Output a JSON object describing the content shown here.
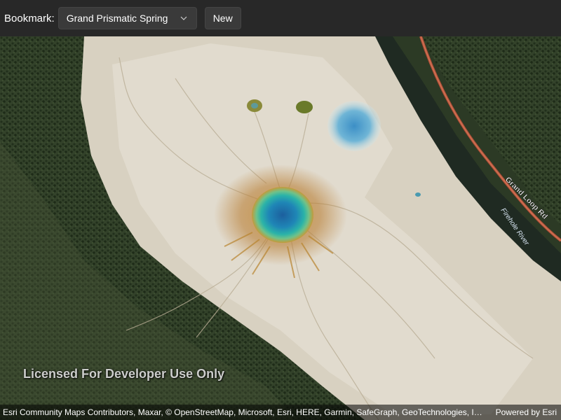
{
  "toolbar": {
    "bookmark_label": "Bookmark:",
    "selected_bookmark": "Grand Prismatic Spring",
    "new_button": "New"
  },
  "map": {
    "road_label": "Grand Loop Rd",
    "river_label": "Firehole River",
    "watermark": "Licensed For Developer Use Only",
    "attribution": "Esri Community Maps Contributors, Maxar, © OpenStreetMap, Microsoft, Esri, HERE, Garmin, SafeGraph, GeoTechnologies, Inc, ME...",
    "powered_by": "Powered by Esri"
  },
  "colors": {
    "toolbar_bg": "#282828",
    "control_bg": "#3a3a3a",
    "forest": "#2f3d22",
    "terrace": "#d9d2c2",
    "spring_center": "#1f7fb0",
    "spring_ring": "#2fbfa6",
    "road": "#b8523a"
  }
}
